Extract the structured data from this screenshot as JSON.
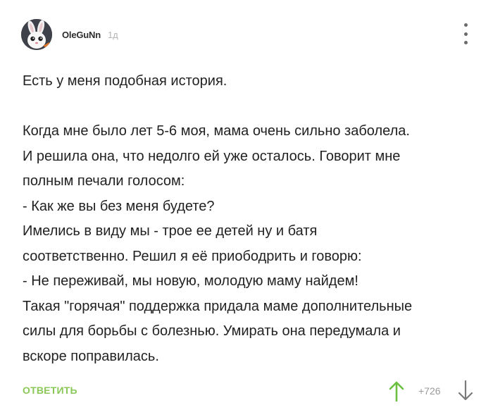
{
  "comment": {
    "author": "OleGuNn",
    "time": "1д",
    "paragraphs": [
      "Есть у меня подобная история.",
      "",
      "Когда мне было лет 5-6 моя, мама очень сильно заболела.",
      "И решила она, что недолго ей уже осталось. Говорит мне",
      "полным печали голосом:",
      "- Как же вы без меня будете?",
      "Имелись в виду мы - трое ее детей ну и батя",
      "соответственно. Решил я её приободрить и говорю:",
      "- Не переживай, мы новую, молодую маму найдем!",
      "Такая \"горячая\" поддержка придала маме дополнительные",
      "силы для борьбы с болезнью. Умирать она передумала и",
      "вскоре поправилась."
    ],
    "reply_label": "ОТВЕТИТЬ",
    "rating": "+726"
  },
  "icons": {
    "avatar": "bunny-avatar",
    "more": "more-vertical-icon",
    "upvote": "arrow-up-icon",
    "downvote": "arrow-down-icon"
  },
  "colors": {
    "accent_green": "#8ac858",
    "upvote_green": "#6cbf3f",
    "downvote_gray": "#7a7a7a",
    "muted_text": "#b4b4b4"
  }
}
